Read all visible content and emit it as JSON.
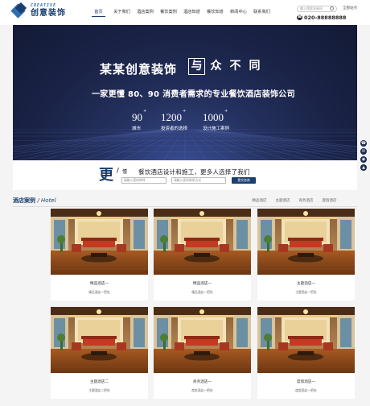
{
  "logo": {
    "en": "CREATIVE",
    "cn": "创意装饰"
  },
  "nav": [
    "首页",
    "关于我们",
    "酒店案例",
    "餐饮案例",
    "酒店知道",
    "餐饮知道",
    "新闻中心",
    "联系我们"
  ],
  "header": {
    "search_placeholder": "输入搜索关键词",
    "link": "全部站点",
    "phone": "020-88888888"
  },
  "banner": {
    "title": "某某创意装饰",
    "boxes": [
      "与",
      "众",
      "不",
      "同"
    ],
    "subtitle": "一家更懂 80、90 消费者需求的专业餐饮酒店装饰公司",
    "stats": [
      {
        "num": "90",
        "plus": "+",
        "label": "城市"
      },
      {
        "num": "1200",
        "plus": "+",
        "label": "投资者的选择"
      },
      {
        "num": "1000",
        "plus": "+",
        "label": "设计施工案例"
      }
    ]
  },
  "side_icons": [
    "phone-icon",
    "chat-icon",
    "qq-icon",
    "top-icon"
  ],
  "strip": {
    "big": "更",
    "slash": "/",
    "small": "懂",
    "text": "餐饮酒店设计和施工，更多人选择了我们",
    "input1": "请输入您的称呼",
    "input2": "请输入您的联系方式",
    "button": "提交咨询"
  },
  "section": {
    "title_cn": "酒店案例",
    "title_en": "/ Hotel",
    "tabs": [
      "精品酒店",
      "主题酒店",
      "商务酒店",
      "度假酒店"
    ]
  },
  "cards": [
    {
      "title": "精品酒店一",
      "category": "精品酒店一把处"
    },
    {
      "title": "精品酒店一",
      "category": "精品酒店一把处"
    },
    {
      "title": "主题酒店一",
      "category": "主题酒店一把处"
    },
    {
      "title": "主题酒店二",
      "category": "主题酒店二把处"
    },
    {
      "title": "商务酒店一",
      "category": "商务酒店一把处"
    },
    {
      "title": "度假酒店一",
      "category": "度假酒店一把处"
    }
  ],
  "colors": {
    "brand": "#1b3f6e",
    "banner": "#1a2346"
  }
}
